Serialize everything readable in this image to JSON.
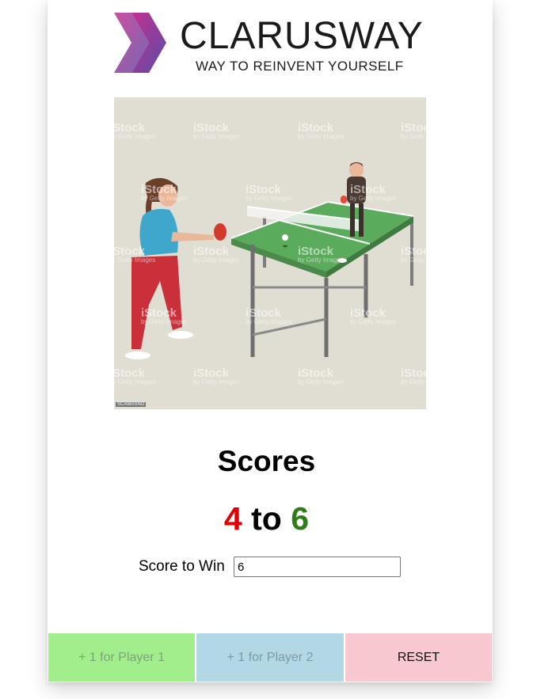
{
  "brand": {
    "name": "CLARUSWAY",
    "slogan": "WAY TO REINVENT YOURSELF"
  },
  "hero": {
    "watermark": "iStock",
    "watermark_sub": "by Getty Images",
    "credit": "SCAMASNO"
  },
  "scores": {
    "title": "Scores",
    "player1": "4",
    "separator": "to",
    "player2": "6"
  },
  "settings": {
    "score_to_win_label": "Score to Win",
    "score_to_win_value": "6"
  },
  "buttons": {
    "player1": "+ 1 for Player 1",
    "player2": "+ 1 for Player 2",
    "reset": "RESET"
  },
  "colors": {
    "player1": "#e00000",
    "player2": "#2e7d16",
    "button1_bg": "#a2ee8d",
    "button2_bg": "#b2d8e6",
    "reset_bg": "#f7c8cf"
  }
}
